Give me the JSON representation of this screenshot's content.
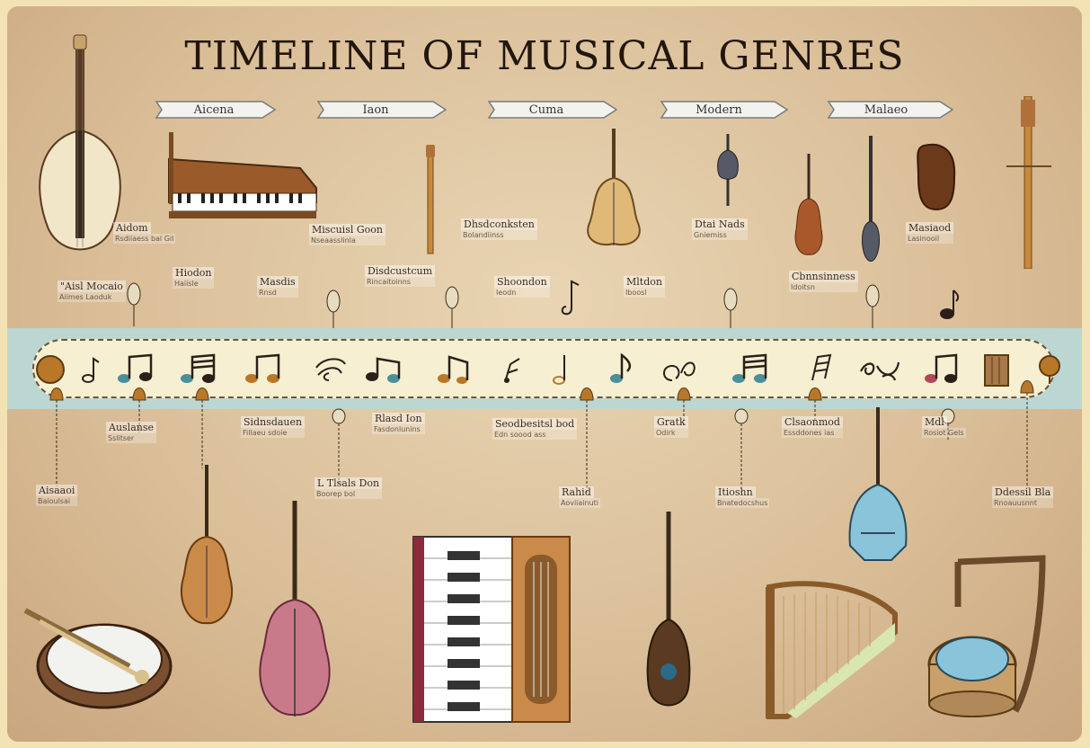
{
  "title": "TIMELINE OF MUSICAL GENRES",
  "eras": [
    {
      "label": "Aicena"
    },
    {
      "label": "Iaon"
    },
    {
      "label": "Cuma"
    },
    {
      "label": "Modern"
    },
    {
      "label": "Malaeo"
    }
  ],
  "labels": [
    {
      "heading": "Aidom",
      "text": "Rsdiiaess bal Gil"
    },
    {
      "heading": "\"Aisl Mocaio",
      "text": "Aiimes Laoduk"
    },
    {
      "heading": "Hiodon",
      "text": "Haiisle"
    },
    {
      "heading": "Miscuisl Goon",
      "text": "Nseaasslinla"
    },
    {
      "heading": "Masdis",
      "text": "Rnsd"
    },
    {
      "heading": "Disdcustcum",
      "text": "Rincaitoinns"
    },
    {
      "heading": "Dhsdconksten",
      "text": "Bolandiinss"
    },
    {
      "heading": "Shoondon",
      "text": "Ieodn"
    },
    {
      "heading": "Mltdon",
      "text": "Iboosl"
    },
    {
      "heading": "Dtai Nads",
      "text": "Gniemiss"
    },
    {
      "heading": "Cbnnsinness",
      "text": "Idoitsn"
    },
    {
      "heading": "Masiaod",
      "text": "Lasinooil"
    },
    {
      "heading": "Auslanse",
      "text": "Sslitser"
    },
    {
      "heading": "Sidnsdauen",
      "text": "Fillaeu sdoie"
    },
    {
      "heading": "Rlasd Ion",
      "text": "Fasdonlunins"
    },
    {
      "heading": "Seodbesitsl bod",
      "text": "Edn soood ass"
    },
    {
      "heading": "Gratk",
      "text": "Odirk"
    },
    {
      "heading": "Clsaonmod",
      "text": "Essddones ias"
    },
    {
      "heading": "Mdl",
      "text": "Rosiot Gels"
    },
    {
      "heading": "Aisaaoi",
      "text": "Baioulsai"
    },
    {
      "heading": "L Tlsals Don",
      "text": "Boorep bol"
    },
    {
      "heading": "Rahid",
      "text": "Aoviiainuti"
    },
    {
      "heading": "Itioshn",
      "text": "Bnatedocshus"
    },
    {
      "heading": "Ddessil Bla",
      "text": "Rnoauusnnt"
    }
  ],
  "colors": {
    "background": "#d9bd97",
    "band": "#bcd6d2",
    "scroll": "#f6efd2",
    "note_teal": "#4a8f9a",
    "note_dark": "#2a2018",
    "note_orange": "#b9772a",
    "note_pink": "#b0485a"
  },
  "instruments": [
    "lute-icon",
    "piano-icon",
    "flute-icon",
    "cello-icon",
    "ukulele-icon",
    "violin-icon",
    "sitar-icon",
    "bouzouki-icon",
    "shamisen-icon",
    "drum-icon",
    "violin-icon",
    "viola-icon",
    "accordion-icon",
    "mandolin-icon",
    "harp-icon",
    "lyre-drum-icon",
    "balalaika-icon"
  ]
}
